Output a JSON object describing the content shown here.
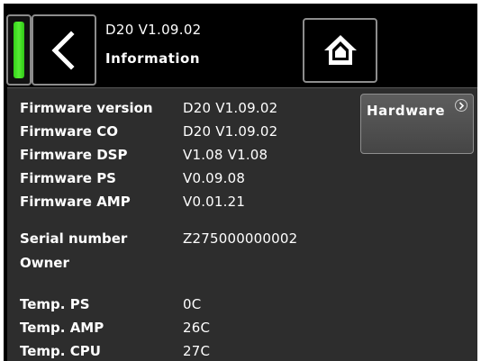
{
  "header": {
    "firmware_title": "D20 V1.09.02",
    "page_title": "Information"
  },
  "colors": {
    "status_led": "#43dd22",
    "content_bg": "#2d2d2d",
    "header_bg": "#000000"
  },
  "icons": {
    "back": "chevron-left-icon",
    "home": "home-icon",
    "hardware": "chevron-right-icon"
  },
  "hardware_button": {
    "label": "Hardware"
  },
  "info": {
    "firmware_version": {
      "label": "Firmware version",
      "value": "D20 V1.09.02"
    },
    "firmware_co": {
      "label": "Firmware CO",
      "value": "D20 V1.09.02"
    },
    "firmware_dsp": {
      "label": "Firmware DSP",
      "value": "V1.08 V1.08"
    },
    "firmware_ps": {
      "label": "Firmware PS",
      "value": "V0.09.08"
    },
    "firmware_amp": {
      "label": "Firmware AMP",
      "value": "V0.01.21"
    },
    "serial_number": {
      "label": "Serial number",
      "value": "Z275000000002"
    },
    "owner": {
      "label": "Owner",
      "value": ""
    },
    "temp_ps": {
      "label": "Temp. PS",
      "value": "0C"
    },
    "temp_amp": {
      "label": "Temp. AMP",
      "value": "26C"
    },
    "temp_cpu": {
      "label": "Temp. CPU",
      "value": "27C"
    }
  }
}
